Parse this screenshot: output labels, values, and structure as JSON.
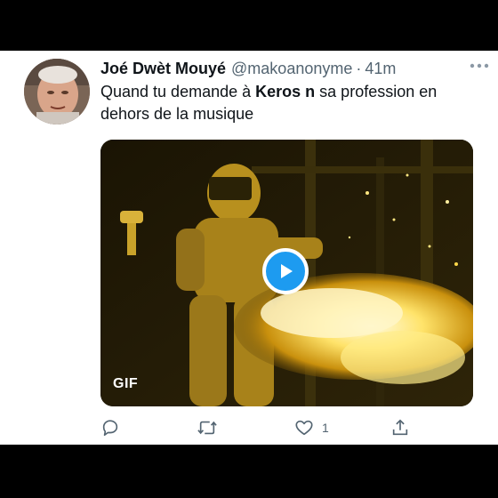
{
  "tweet": {
    "author_name": "Joé Dwèt Mouyé",
    "author_handle": "@makoanonyme",
    "separator": "·",
    "time": "41m",
    "text_before": "Quand tu demande à ",
    "text_bold": "Keros n",
    "text_after": " sa profession en dehors de la musique",
    "media_badge": "GIF",
    "actions": {
      "reply_icon": "reply-icon",
      "retweet_icon": "retweet-icon",
      "like_icon": "heart-icon",
      "like_count": "1",
      "share_icon": "share-icon"
    }
  },
  "colors": {
    "accent": "#1d9bf0",
    "text_primary": "#0f1419",
    "text_secondary": "#536471",
    "background": "#ffffff",
    "letterbox": "#000000"
  }
}
